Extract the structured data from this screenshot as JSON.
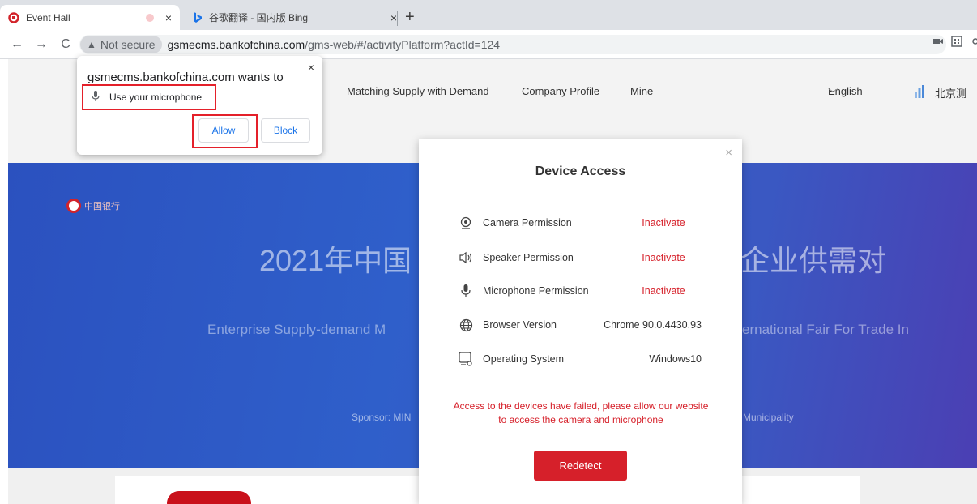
{
  "browser": {
    "tabs": [
      {
        "title": "Event Hall",
        "close": "×"
      },
      {
        "title": "谷歌翻译 - 国内版 Bing",
        "close": "×"
      }
    ],
    "new_tab": "+",
    "nav": {
      "back": "←",
      "forward": "→",
      "reload": "C"
    },
    "not_secure": "Not secure",
    "url_host": "gsmecms.bankofchina.com",
    "url_path": "/gms-web/#/activityPlatform?actId=124"
  },
  "permission_prompt": {
    "heading": "gsmecms.bankofchina.com wants to",
    "item": "Use your microphone",
    "allow": "Allow",
    "block": "Block",
    "close": "×"
  },
  "site_nav": {
    "items": [
      "Matching Supply with Demand",
      "Company Profile",
      "Mine"
    ],
    "language": "English",
    "region": "北京测"
  },
  "banner": {
    "title_left": "2021年中国",
    "title_right": "企业供需对",
    "subtitle_left": "Enterprise Supply-demand M",
    "subtitle_right": "ernational Fair For Trade In",
    "sponsor_left": "Sponsor: MIN",
    "sponsor_right": "Municipality",
    "logo_text": "中国银行"
  },
  "modal": {
    "title": "Device Access",
    "close": "×",
    "rows": [
      {
        "label": "Camera Permission",
        "value": "Inactivate"
      },
      {
        "label": "Speaker Permission",
        "value": "Inactivate"
      },
      {
        "label": "Microphone Permission",
        "value": "Inactivate"
      },
      {
        "label": "Browser Version",
        "value": "Chrome 90.0.4430.93"
      },
      {
        "label": "Operating System",
        "value": "Windows10"
      }
    ],
    "error": "Access to the devices have failed, please allow our website to access the camera and microphone",
    "button": "Redetect"
  },
  "colors": {
    "accent_red": "#d6202a",
    "banner_blue": "#2f5fca"
  }
}
